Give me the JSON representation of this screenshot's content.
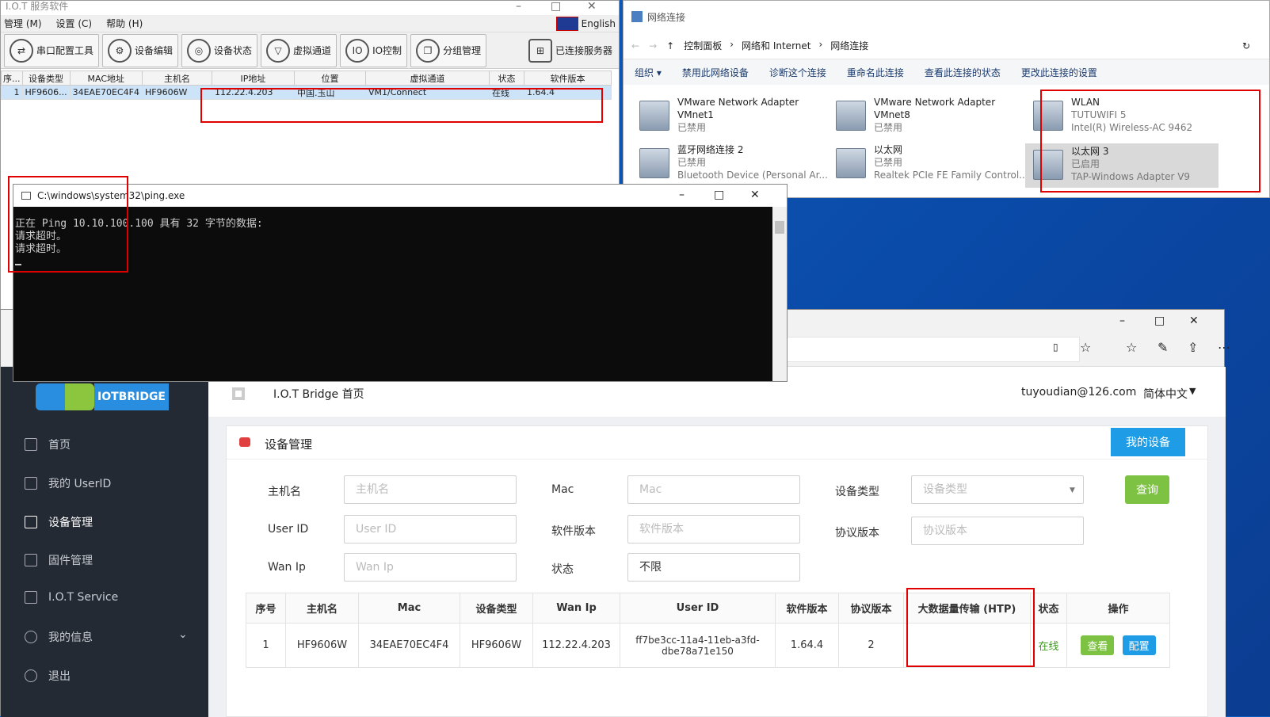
{
  "iot": {
    "title": "I.O.T 服务软件",
    "menu": [
      "管理 (M)",
      "设置 (C)",
      "帮助 (H)"
    ],
    "lang": "English",
    "tools": [
      "串口配置工具",
      "设备编辑",
      "设备状态",
      "虚拟通道",
      "IO控制",
      "分组管理"
    ],
    "tool_icons": [
      "serial-icon",
      "device-edit-icon",
      "device-status-icon",
      "virtual-channel-icon",
      "io-control-icon",
      "group-icon"
    ],
    "server_btn": "已连接服务器",
    "headers": [
      "序...",
      "设备类型",
      "MAC地址",
      "主机名",
      "IP地址",
      "位置",
      "虚拟通道",
      "状态",
      "软件版本"
    ],
    "row": [
      "1",
      "HF9606...",
      "34EAE70EC4F4",
      "HF9606W",
      "112.22.4.203",
      "中国.玉山",
      "VM1/Connect",
      "在线",
      "1.64.4"
    ]
  },
  "net": {
    "title": "网络连接",
    "crumbs": [
      "控制面板",
      "网络和 Internet",
      "网络连接"
    ],
    "actions": [
      "组织 ▾",
      "禁用此网络设备",
      "诊断这个连接",
      "重命名此连接",
      "查看此连接的状态",
      "更改此连接的设置"
    ],
    "adapters": [
      {
        "name": "VMware Network Adapter",
        "line2": "VMnet1",
        "status": "已禁用"
      },
      {
        "name": "VMware Network Adapter",
        "line2": "VMnet8",
        "status": "已禁用"
      },
      {
        "name": "WLAN",
        "line2": "TUTUWIFI 5",
        "status": "Intel(R) Wireless-AC 9462"
      },
      {
        "name": "蓝牙网络连接 2",
        "line2": "已禁用",
        "status": "Bluetooth Device (Personal Ar..."
      },
      {
        "name": "以太网",
        "line2": "已禁用",
        "status": "Realtek PCIe FE Family Control..."
      },
      {
        "name": "以太网 3",
        "line2": "已启用",
        "status": "TAP-Windows Adapter V9"
      }
    ]
  },
  "cmd": {
    "title": "C:\\windows\\system32\\ping.exe",
    "lines": [
      "正在 Ping 10.10.100.100 具有 32 字节的数据:",
      "请求超时。",
      "请求超时。"
    ]
  },
  "web": {
    "logo": "IOTBRIDGE",
    "crumb": "I.O.T Bridge 首页",
    "user": "tuyoudian@126.com",
    "lang": "简体中文",
    "nav": [
      "首页",
      "我的 UserID",
      "设备管理",
      "固件管理",
      "I.O.T Service",
      "我的信息",
      "退出"
    ],
    "card_title": "设备管理",
    "my_devices": "我的设备",
    "form": {
      "host_label": "主机名",
      "host_ph": "主机名",
      "mac_label": "Mac",
      "mac_ph": "Mac",
      "type_label": "设备类型",
      "type_ph": "设备类型",
      "uid_label": "User ID",
      "uid_ph": "User ID",
      "sw_label": "软件版本",
      "sw_ph": "软件版本",
      "proto_label": "协议版本",
      "proto_ph": "协议版本",
      "wan_label": "Wan Ip",
      "wan_ph": "Wan Ip",
      "state_label": "状态",
      "state_val": "不限",
      "query": "查询"
    },
    "table_headers": [
      "序号",
      "主机名",
      "Mac",
      "设备类型",
      "Wan Ip",
      "User ID",
      "软件版本",
      "协议版本",
      "大数据量传输 (HTP)",
      "状态",
      "操作"
    ],
    "row": {
      "no": "1",
      "host": "HF9606W",
      "mac": "34EAE70EC4F4",
      "type": "HF9606W",
      "wan": "112.22.4.203",
      "uid": "ff7be3cc-11a4-11eb-a3fd-dbe78a71e150",
      "sw": "1.64.4",
      "proto": "2",
      "htp": "",
      "state": "在线",
      "view": "查看",
      "config": "配置"
    }
  }
}
